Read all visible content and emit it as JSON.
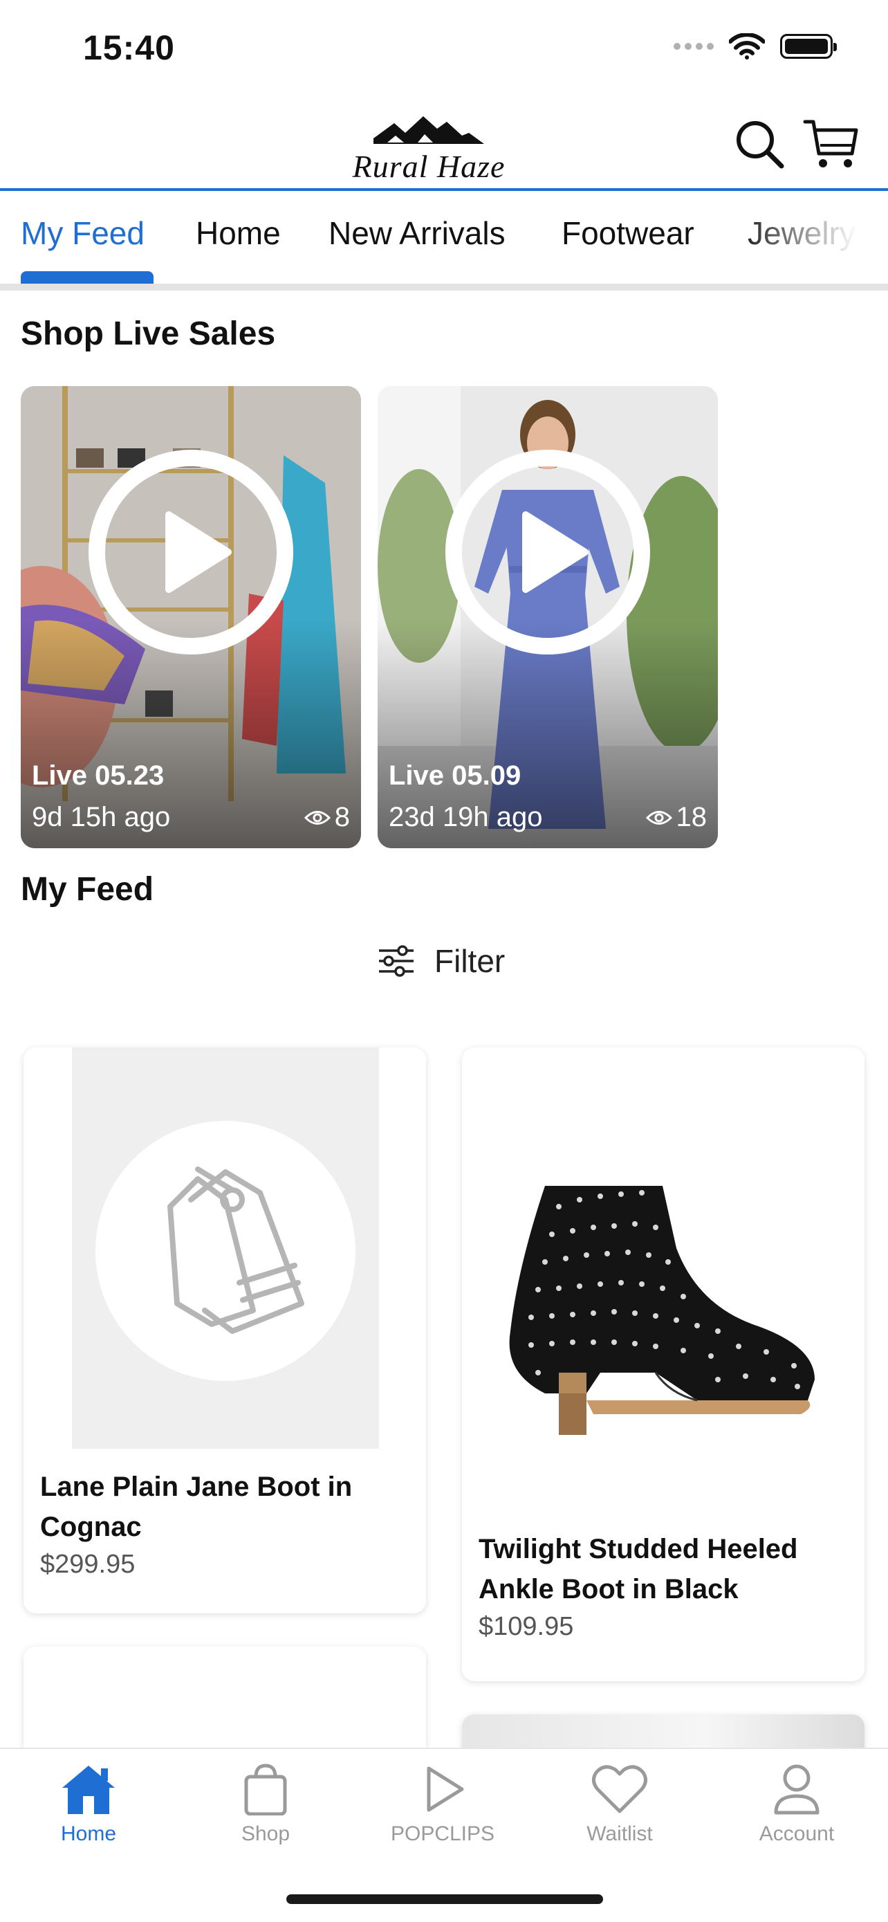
{
  "status_bar": {
    "time": "15:40"
  },
  "header": {
    "logo_text": "RURAL HAZE"
  },
  "tabs": [
    {
      "label": "My Feed",
      "active": true
    },
    {
      "label": "Home"
    },
    {
      "label": "New Arrivals"
    },
    {
      "label": "Footwear"
    },
    {
      "label": "Jewelry"
    }
  ],
  "live_sales": {
    "title": "Shop Live Sales",
    "items": [
      {
        "title": "Live 05.23",
        "ago": "9d 15h ago",
        "views": "8"
      },
      {
        "title": "Live 05.09",
        "ago": "23d 19h ago",
        "views": "18"
      }
    ]
  },
  "feed": {
    "title": "My Feed",
    "filter_label": "Filter",
    "products": [
      {
        "name": "Lane Plain Jane Boot in Cognac",
        "price": "$299.95",
        "image": "tag-placeholder-icon"
      },
      {
        "name": "Twilight Studded Heeled Ankle Boot in Black",
        "price": "$109.95",
        "image": "studded-ankle-boot"
      }
    ]
  },
  "bottom_nav": [
    {
      "label": "Home",
      "icon": "home-icon",
      "active": true
    },
    {
      "label": "Shop",
      "icon": "shopping-bag-icon"
    },
    {
      "label": "POPCLIPS",
      "icon": "play-icon"
    },
    {
      "label": "Waitlist",
      "icon": "heart-icon"
    },
    {
      "label": "Account",
      "icon": "person-icon"
    }
  ],
  "colors": {
    "accent": "#1f6ed4",
    "inactive": "#9a9a9a",
    "divider": "#e3e3e3"
  }
}
